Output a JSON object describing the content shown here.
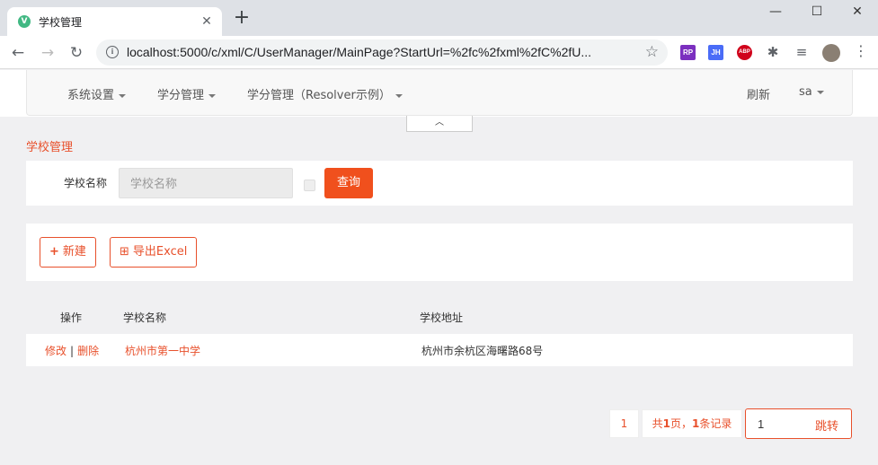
{
  "browser": {
    "tab_title": "学校管理",
    "favicon_letter": "V",
    "url": "localhost:5000/c/xml/C/UserManager/MainPage?StartUrl=%2fc%2fxml%2fC%2fU...",
    "extensions": [
      {
        "name": "rp-extension-icon",
        "label": "RP",
        "color": "#7b2fbf"
      },
      {
        "name": "jh-extension-icon",
        "label": "JH",
        "color": "#4a6cf7"
      },
      {
        "name": "adblock-icon",
        "label": "ABP",
        "color": "#d0021b"
      }
    ]
  },
  "nav": {
    "items": [
      "系统设置",
      "学分管理",
      "学分管理（Resolver示例）"
    ],
    "refresh": "刷新",
    "user": "sa"
  },
  "page": {
    "title": "学校管理"
  },
  "search": {
    "label": "学校名称",
    "placeholder": "学校名称",
    "query_button": "查询"
  },
  "actions": {
    "new_button": "新建",
    "export_button": "导出Excel"
  },
  "table": {
    "headers": [
      "操作",
      "学校名称",
      "学校地址"
    ],
    "rows": [
      {
        "edit": "修改",
        "delete": "删除",
        "name": "杭州市第一中学",
        "address": "杭州市余杭区海曙路68号"
      }
    ]
  },
  "pagination": {
    "current_page": "1",
    "info_prefix": "共",
    "total_pages": "1",
    "info_mid": "页，",
    "total_records": "1",
    "info_suffix": "条记录",
    "jump_value": "1",
    "jump_button": "跳转"
  },
  "colors": {
    "accent": "#e8502b",
    "primary_button": "#f0501d"
  }
}
